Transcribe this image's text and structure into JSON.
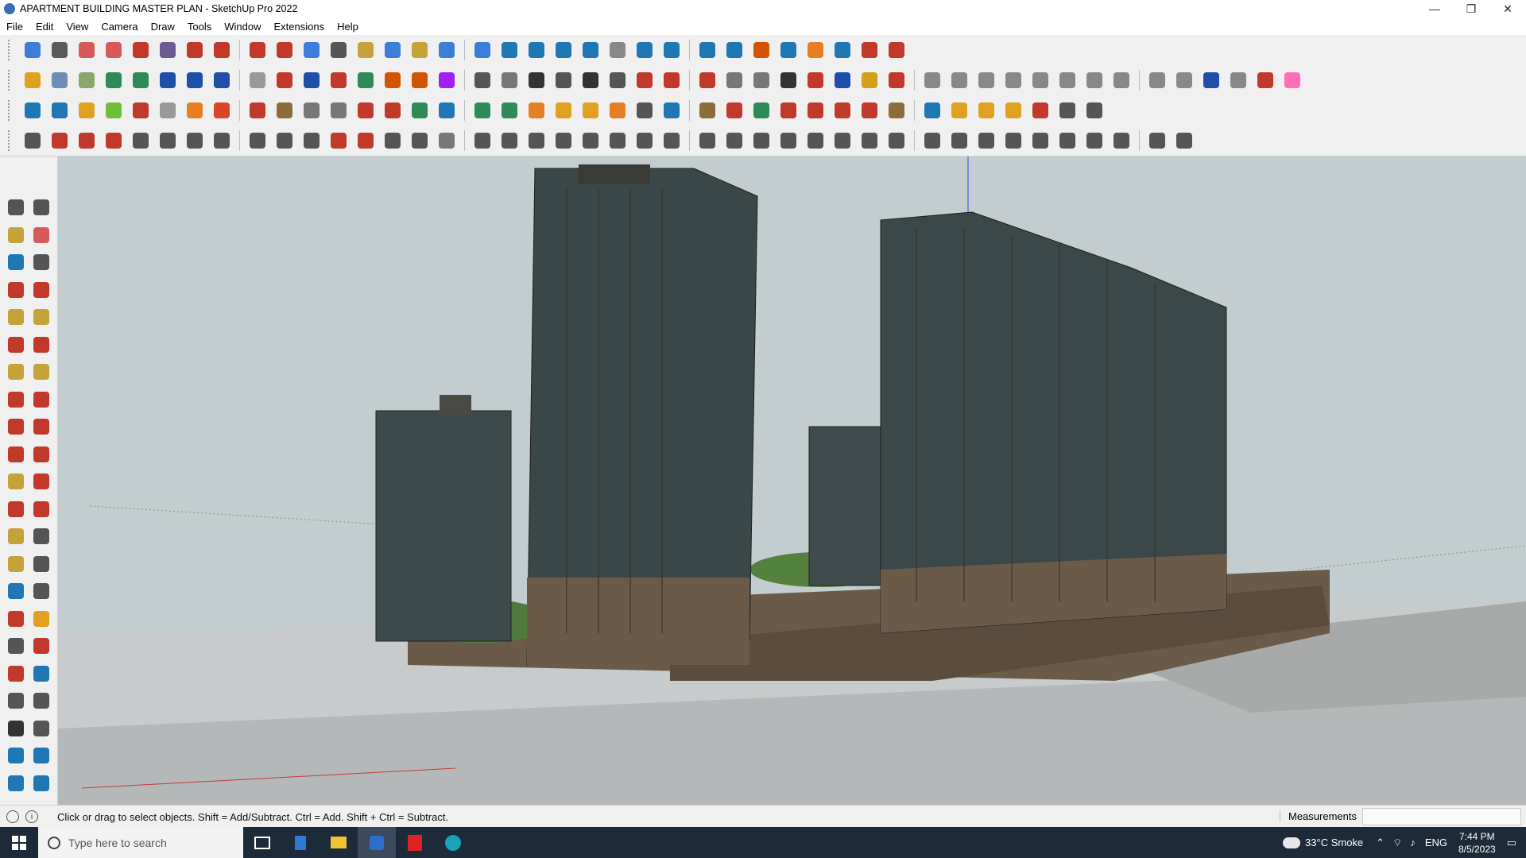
{
  "window": {
    "title": "APARTMENT BUILDING MASTER PLAN - SketchUp Pro 2022",
    "minimize_glyph": "—",
    "restore_glyph": "❐",
    "close_glyph": "✕"
  },
  "menu": [
    "File",
    "Edit",
    "View",
    "Camera",
    "Draw",
    "Tools",
    "Window",
    "Extensions",
    "Help"
  ],
  "status": {
    "hint": "Click or drag to select objects. Shift = Add/Subtract. Ctrl = Add. Shift + Ctrl = Subtract.",
    "info_glyph": "i",
    "measurements_label": "Measurements",
    "measurements_value": ""
  },
  "taskbar": {
    "search_placeholder": "Type here to search",
    "weather": "33°C  Smoke",
    "language": "ENG",
    "time": "7:44 PM",
    "date": "8/5/2023",
    "pinned_icons": [
      "task-view-icon",
      "calculator-icon",
      "file-explorer-icon",
      "sketchup-icon",
      "acrobat-icon",
      "edge-icon"
    ]
  },
  "toolbar_rows": [
    [
      "#3b7dd8",
      "#5a5a5a",
      "#d65a5a",
      "#d65a5a",
      "#c0392b",
      "#6b5b95",
      "#c0392b",
      "#c0392b",
      "#c0392b",
      "#c0392b",
      "#3b7dd8",
      "#555",
      "#c6a23a",
      "#3b7dd8",
      "#c6a23a",
      "#3b7dd8",
      "#3b7dd8",
      "#1f77b4",
      "#1f77b4",
      "#1f77b4",
      "#1f77b4",
      "#888",
      "#1f77b4",
      "#1f77b4",
      "#1f77b4",
      "#1f77b4",
      "#d35400",
      "#1f77b4",
      "#e67e22",
      "#1f77b4",
      "#c0392b",
      "#c0392b"
    ],
    [
      "#e0a020",
      "#6d8fb5",
      "#8aa66a",
      "#2e8b57",
      "#2e8b57",
      "#1f4fa8",
      "#1f4fa8",
      "#1f4fa8",
      "#999",
      "#c0392b",
      "#1f4fa8",
      "#c0392b",
      "#2e8b57",
      "#d35400",
      "#d35400",
      "#a020f0",
      "#555",
      "#777",
      "#333",
      "#555",
      "#333",
      "#555",
      "#c0392b",
      "#c0392b",
      "#c0392b",
      "#777",
      "#777",
      "#333",
      "#c0392b",
      "#1f4fa8",
      "#d4a017",
      "#c0392b",
      "#888",
      "#888",
      "#888",
      "#888",
      "#888",
      "#888",
      "#888",
      "#888",
      "#888",
      "#888",
      "#1f4fa8",
      "#888",
      "#c0392b",
      "#ff6fb5"
    ],
    [
      "#1f77b4",
      "#1f77b4",
      "#e0a020",
      "#6bbf3a",
      "#c0392b",
      "#999",
      "#e67e22",
      "#d9442a",
      "#c0392b",
      "#8a6d3b",
      "#777",
      "#777",
      "#c0392b",
      "#c0392b",
      "#2e8b57",
      "#1f77b4",
      "#2e8b57",
      "#2e8b57",
      "#e67e22",
      "#e0a020",
      "#e0a020",
      "#e67e22",
      "#555",
      "#1f77b4",
      "#8a6d3b",
      "#c0392b",
      "#2e8b57",
      "#c0392b",
      "#c0392b",
      "#c0392b",
      "#c0392b",
      "#8a6d3b",
      "#1f77b4",
      "#e0a020",
      "#e0a020",
      "#e0a020",
      "#c0392b",
      "#555",
      "#555"
    ],
    [
      "#555",
      "#c0392b",
      "#c0392b",
      "#c0392b",
      "#555",
      "#555",
      "#555",
      "#555",
      "#555",
      "#555",
      "#555",
      "#c0392b",
      "#c0392b",
      "#555",
      "#555",
      "#777",
      "#555",
      "#555",
      "#555",
      "#555",
      "#555",
      "#555",
      "#555",
      "#555",
      "#555",
      "#555",
      "#555",
      "#555",
      "#555",
      "#555",
      "#555",
      "#555",
      "#555",
      "#555",
      "#555",
      "#555",
      "#555",
      "#555",
      "#555",
      "#555",
      "#555",
      "#555"
    ]
  ],
  "left_palette": [
    "#555",
    "#555",
    "#c6a23a",
    "#d65a5a",
    "#1f77b4",
    "#555",
    "#c0392b",
    "#c0392b",
    "#c6a23a",
    "#c6a23a",
    "#c0392b",
    "#c0392b",
    "#c6a23a",
    "#c6a23a",
    "#c0392b",
    "#c0392b",
    "#c0392b",
    "#c0392b",
    "#c0392b",
    "#c0392b",
    "#c6a23a",
    "#c0392b",
    "#c0392b",
    "#c0392b",
    "#c6a23a",
    "#555",
    "#c6a23a",
    "#555",
    "#1f77b4",
    "#555",
    "#c0392b",
    "#e0a020",
    "#555",
    "#c0392b",
    "#c0392b",
    "#1f77b4",
    "#555",
    "#555",
    "#333",
    "#555",
    "#1f77b4",
    "#1f77b4",
    "#1f77b4",
    "#1f77b4"
  ],
  "scene": {
    "sky_color": "#c3cdcf",
    "ground_color": "#b9bbbb",
    "tower_color": "#3d4a4b",
    "podium_color": "#6b5a47",
    "trees_color": "#4f7a3b"
  }
}
